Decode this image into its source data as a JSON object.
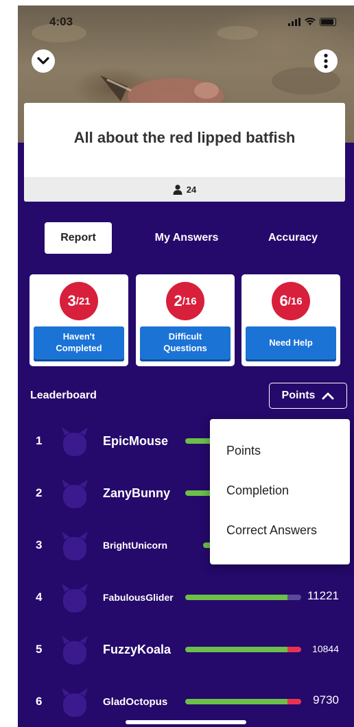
{
  "status_bar": {
    "time": "4:03"
  },
  "quiz": {
    "title": "All about the red lipped batfish",
    "player_count": "24"
  },
  "tabs": [
    {
      "label": "Report",
      "active": true
    },
    {
      "label": "My Answers",
      "active": false
    },
    {
      "label": "Accuracy",
      "active": false
    }
  ],
  "stats": [
    {
      "count": "3",
      "total": "/21",
      "label_line1": "Haven't",
      "label_line2": "Completed"
    },
    {
      "count": "2",
      "total": "/16",
      "label_line1": "Difficult",
      "label_line2": "Questions"
    },
    {
      "count": "6",
      "total": "/16",
      "label_line1": "Need Help",
      "label_line2": ""
    }
  ],
  "leaderboard": {
    "label": "Leaderboard",
    "sort_label": "Points",
    "rows": [
      {
        "rank": "1",
        "name": "EpicMouse",
        "score": "",
        "green": 1.0,
        "red": 0.0
      },
      {
        "rank": "2",
        "name": "ZanyBunny",
        "score": "",
        "green": 1.0,
        "red": 0.0
      },
      {
        "rank": "3",
        "name": "BrightUnicorn",
        "score": "",
        "green": 1.0,
        "red": 0.0
      },
      {
        "rank": "4",
        "name": "FabulousGlider",
        "score": "11221",
        "green": 0.88,
        "red": 0.0
      },
      {
        "rank": "5",
        "name": "FuzzyKoala",
        "score": "10844",
        "green": 0.88,
        "red": 0.12
      },
      {
        "rank": "6",
        "name": "GladOctopus",
        "score": "9730",
        "green": 0.88,
        "red": 0.12
      }
    ]
  },
  "dropdown": {
    "options": [
      "Points",
      "Completion",
      "Correct Answers"
    ]
  },
  "colors": {
    "background": "#25096b",
    "accent_red": "#d81f3b",
    "button_blue": "#1b73d6",
    "bar_green": "#6cc04a",
    "bar_red": "#e8334f"
  }
}
